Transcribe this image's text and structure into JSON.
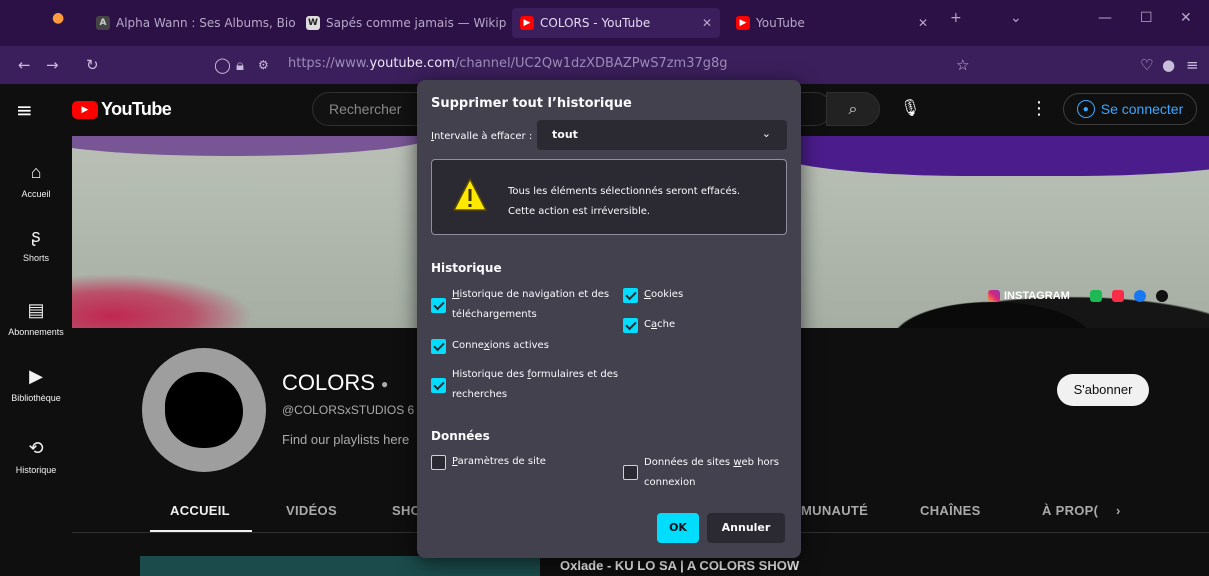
{
  "browser": {
    "tabs": [
      {
        "label": "Alpha Wann : Ses Albums, Biog",
        "fav": "A"
      },
      {
        "label": "Sapés comme jamais — Wikipé",
        "fav": "W"
      },
      {
        "label": "COLORS - YouTube",
        "fav": "▶"
      },
      {
        "label": "YouTube",
        "fav": "▶"
      }
    ],
    "url_prefix": "https://www.",
    "url_host": "youtube.com",
    "url_path": "/channel/UC2Qw1dzXDBAZPwS7zm37g8g"
  },
  "youtube": {
    "logo_text": "YouTube",
    "search_placeholder": "Rechercher",
    "sign_in": "Se connecter",
    "sidebar": [
      {
        "label": "Accueil",
        "icon": "⌂"
      },
      {
        "label": "Shorts",
        "icon": "ʂ"
      },
      {
        "label": "Abonnements",
        "icon": "▤"
      },
      {
        "label": "Bibliothèque",
        "icon": "▶"
      },
      {
        "label": "Historique",
        "icon": "⟲"
      }
    ],
    "social_label": "INSTAGRAM",
    "channel": {
      "name": "COLORS",
      "handle": "@COLORSxSTUDIOS",
      "handle_suffix": "6",
      "description": "Find our playlists here",
      "subscribe": "S'abonner"
    },
    "tabs": [
      "ACCUEIL",
      "VIDÉOS",
      "SHO",
      "MUNAUTÉ",
      "CHAÎNES",
      "À PROP("
    ],
    "video_title": "Oxlade - KU LO SA | A COLORS SHOW"
  },
  "dialog": {
    "title": "Supprimer tout l’historique",
    "range_label_first": "I",
    "range_label_rest": "ntervalle à effacer :",
    "range_value": "tout",
    "warning_line1": "Tous les éléments sélectionnés seront effacés.",
    "warning_line2": "Cette action est irréversible.",
    "history_section": "Historique",
    "data_section": "Données",
    "options": {
      "nav_u": "H",
      "nav_rest": "istorique de navigation et des",
      "nav_line2": "téléchargements",
      "cookies_u": "C",
      "cookies_rest": "ookies",
      "cache_a": "C",
      "cache_u": "a",
      "cache_rest": "che",
      "sessions_a": "Conne",
      "sessions_u": "x",
      "sessions_rest": "ions actives",
      "forms_a": "Historique des ",
      "forms_u": "f",
      "forms_rest": "ormulaires et des",
      "forms_line2": "recherches",
      "site_u": "P",
      "site_rest": "aramètres de site",
      "offline_a": "Données de sites ",
      "offline_u": "w",
      "offline_rest": "eb hors",
      "offline_line2": "connexion"
    },
    "ok": "OK",
    "cancel": "Annuler"
  },
  "colors": {
    "accent": "#00ddff",
    "dialog_bg": "#42414d",
    "youtube_red": "#ff0000",
    "link_blue": "#3ea6ff"
  }
}
